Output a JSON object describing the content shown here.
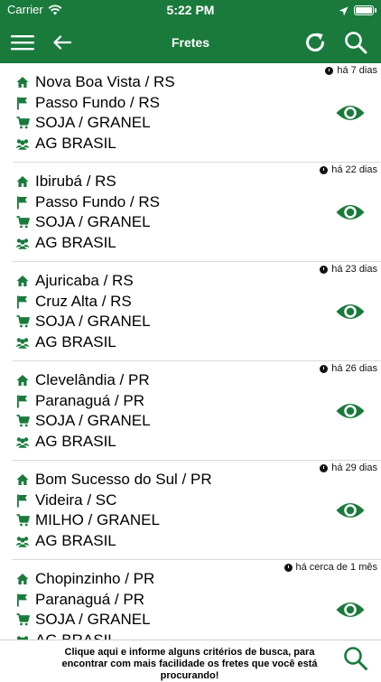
{
  "status": {
    "carrier": "Carrier",
    "time": "5:22 PM"
  },
  "nav": {
    "title": "Fretes",
    "menu_icon": "menu-icon",
    "back_icon": "back-arrow-icon",
    "refresh_icon": "refresh-icon",
    "search_icon": "search-icon"
  },
  "colors": {
    "brand": "#1a7a3c"
  },
  "items": [
    {
      "ago": "há 7 dias",
      "origin": "Nova Boa Vista / RS",
      "destination": "Passo Fundo / RS",
      "product": "SOJA / GRANEL",
      "company": "AG BRASIL"
    },
    {
      "ago": "há 22 dias",
      "origin": "Ibirubá / RS",
      "destination": "Passo Fundo / RS",
      "product": "SOJA / GRANEL",
      "company": "AG BRASIL"
    },
    {
      "ago": "há 23 dias",
      "origin": "Ajuricaba / RS",
      "destination": "Cruz Alta / RS",
      "product": "SOJA / GRANEL",
      "company": "AG BRASIL"
    },
    {
      "ago": "há 26 dias",
      "origin": "Clevelândia / PR",
      "destination": "Paranaguá / PR",
      "product": "SOJA / GRANEL",
      "company": "AG BRASIL"
    },
    {
      "ago": "há 29 dias",
      "origin": "Bom Sucesso do Sul / PR",
      "destination": "Videira / SC",
      "product": "MILHO / GRANEL",
      "company": "AG BRASIL"
    },
    {
      "ago": "há cerca de 1 mês",
      "origin": "Chopinzinho / PR",
      "destination": "Paranaguá / PR",
      "product": "SOJA / GRANEL",
      "company": "AG BRASIL"
    }
  ],
  "footer": {
    "text": "Clique aqui e informe alguns critérios de busca, para encontrar com mais facilidade os fretes que você está procurando!"
  }
}
